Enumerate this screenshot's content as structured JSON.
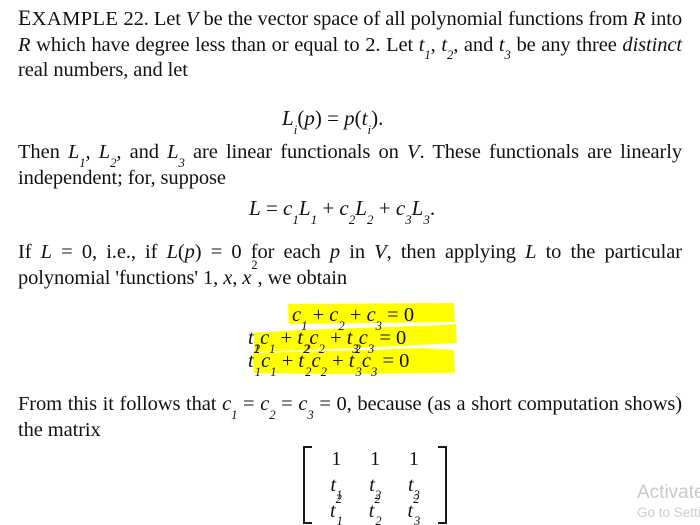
{
  "document": {
    "type": "scanned-textbook-page",
    "background_color": "#ffffff",
    "text_color": "#111111",
    "highlight_color": "#FFFF00"
  },
  "paragraphs": {
    "p1": {
      "label_prefix": "E",
      "label_rest": "XAMPLE",
      "label_number": "22.",
      "seg_a": " Let ",
      "var_v": "V",
      "seg_b": " be the vector space of all polynomial functions from ",
      "var_r1": "R",
      "seg_c": " into ",
      "var_r2": "R",
      "seg_d": " which have degree less than or equal to 2. Let ",
      "var_t1": "t",
      "sub_t1": "1",
      "seg_e": ", ",
      "var_t2": "t",
      "sub_t2": "2",
      "seg_f": ", and ",
      "var_t3": "t",
      "sub_t3": "3",
      "seg_g": " be any three ",
      "emph": "distinct",
      "seg_h": " real numbers, and let"
    },
    "p2": {
      "seg_a": "Then ",
      "l1": "L",
      "l1sub": "1",
      "seg_b": ", ",
      "l2": "L",
      "l2sub": "2",
      "seg_c": ", and ",
      "l3": "L",
      "l3sub": "3",
      "seg_d": " are linear functionals on ",
      "var_v": "V",
      "seg_e": ". These functionals are linearly independent; for, suppose"
    },
    "p3": {
      "seg_a": "If ",
      "var_l1": "L",
      "seg_b": " = 0, i.e., if ",
      "var_l2": "L",
      "seg_c": "(",
      "var_p1": "p",
      "seg_d": ") = 0 for each ",
      "var_p2": "p",
      "seg_e": " in ",
      "var_v": "V",
      "seg_f": ", then applying ",
      "var_l3": "L",
      "seg_g": " to the particular polynomial 'functions' 1, ",
      "var_x1": "x",
      "seg_h": ", ",
      "var_x2": "x",
      "sup_x2": "2",
      "seg_i": ", we obtain"
    },
    "p4": {
      "seg_a": "From this it follows that ",
      "c1": "c",
      "c1sub": "1",
      "seg_b": " = ",
      "c2": "c",
      "c2sub": "2",
      "seg_c": " = ",
      "c3": "c",
      "c3sub": "3",
      "seg_d": " = 0, because (as a short computation shows) the matrix"
    }
  },
  "equations": {
    "eq_li": {
      "l": "L",
      "lsub": "i",
      "open": "(",
      "p": "p",
      "close": ")",
      "eq": " = ",
      "p2": "p",
      "open2": "(",
      "t": "t",
      "tsub": "i",
      "close2": ").",
      "plain": "Li(p) = p(ti)."
    },
    "eq_L": {
      "lhs": "L",
      "eq": " = ",
      "c1": "c",
      "c1sub": "1",
      "L1": "L",
      "L1sub": "1",
      "plus1": " + ",
      "c2": "c",
      "c2sub": "2",
      "L2": "L",
      "L2sub": "2",
      "plus2": " + ",
      "c3": "c",
      "c3sub": "3",
      "L3": "L",
      "L3sub": "3",
      "period": ".",
      "plain": "L = c1L1 + c2L2 + c3L3."
    },
    "system": {
      "highlighted": true,
      "row1": {
        "t1": "",
        "c1": "c",
        "c1sub": "1",
        "plus1": " + ",
        "t2": "",
        "c2": "c",
        "c2sub": "2",
        "plus2": " + ",
        "t3": "",
        "c3": "c",
        "c3sub": "3",
        "eq": " = 0",
        "plain": "c1 + c2 + c3 = 0"
      },
      "row2": {
        "t1": "t",
        "t1sub": "1",
        "c1": "c",
        "c1sub": "1",
        "plus1": " + ",
        "t2": "t",
        "t2sub": "2",
        "c2": "c",
        "c2sub": "2",
        "plus2": " + ",
        "t3": "t",
        "t3sub": "3",
        "c3": "c",
        "c3sub": "3",
        "eq": " = 0",
        "plain": "t1c1 + t2c2 + t3c3 = 0"
      },
      "row3": {
        "t1": "t",
        "t1sub": "1",
        "t1sup": "2",
        "c1": "c",
        "c1sub": "1",
        "plus1": " + ",
        "t2": "t",
        "t2sub": "2",
        "t2sup": "2",
        "c2": "c",
        "c2sub": "2",
        "plus2": " + ",
        "t3": "t",
        "t3sub": "3",
        "t3sup": "2",
        "c3": "c",
        "c3sub": "3",
        "eq": " = 0",
        "plain": "t1^2c1 + t2^2c2 + t3^2c3 = 0"
      }
    }
  },
  "matrix": {
    "rows": [
      [
        "1",
        "1",
        "1"
      ],
      [
        "t1",
        "t2",
        "t3"
      ],
      [
        "t1^2",
        "t2^2",
        "t3^2"
      ]
    ],
    "bracket": "square"
  },
  "watermark": {
    "title": "Activate",
    "subtitle": "Go to Setti",
    "full_title": "Activate Windows",
    "full_subtitle": "Go to Settings to activate Windows.",
    "color": "#c9c9c9"
  }
}
